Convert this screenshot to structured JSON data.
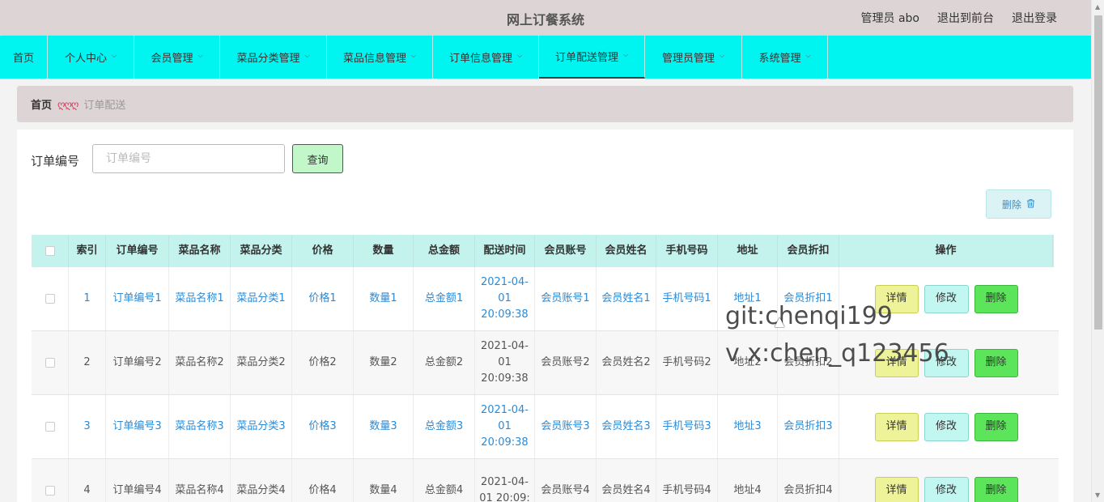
{
  "header": {
    "title": "网上订餐系统",
    "user_label": "管理员 abo",
    "front_link": "退出到前台",
    "logout_link": "退出登录"
  },
  "nav": {
    "home": "首页",
    "items": [
      {
        "label": "个人中心"
      },
      {
        "label": "会员管理"
      },
      {
        "label": "菜品分类管理"
      },
      {
        "label": "菜品信息管理"
      },
      {
        "label": "订单信息管理"
      },
      {
        "label": "订单配送管理",
        "active": true
      },
      {
        "label": "管理员管理"
      },
      {
        "label": "系统管理"
      }
    ],
    "chevron": "⌵"
  },
  "breadcrumb": {
    "home": "首页",
    "separator": "ღღღ",
    "current": "订单配送"
  },
  "search": {
    "label": "订单编号",
    "placeholder": "订单编号",
    "button": "查询"
  },
  "toolbar": {
    "delete_label": "删除",
    "trash_icon": "🗑"
  },
  "table": {
    "headers": [
      "索引",
      "订单编号",
      "菜品名称",
      "菜品分类",
      "价格",
      "数量",
      "总金额",
      "配送时间",
      "会员账号",
      "会员姓名",
      "手机号码",
      "地址",
      "会员折扣",
      "操作"
    ],
    "actions": {
      "detail": "详情",
      "edit": "修改",
      "delete": "删除"
    },
    "rows": [
      [
        "1",
        "订单编号1",
        "菜品名称1",
        "菜品分类1",
        "价格1",
        "数量1",
        "总金额1",
        "2021-04-01 20:09:38",
        "会员账号1",
        "会员姓名1",
        "手机号码1",
        "地址1",
        "会员折扣1"
      ],
      [
        "2",
        "订单编号2",
        "菜品名称2",
        "菜品分类2",
        "价格2",
        "数量2",
        "总金额2",
        "2021-04-01 20:09:38",
        "会员账号2",
        "会员姓名2",
        "手机号码2",
        "地址2",
        "会员折扣2"
      ],
      [
        "3",
        "订单编号3",
        "菜品名称3",
        "菜品分类3",
        "价格3",
        "数量3",
        "总金额3",
        "2021-04-01 20:09:38",
        "会员账号3",
        "会员姓名3",
        "手机号码3",
        "地址3",
        "会员折扣3"
      ],
      [
        "4",
        "订单编号4",
        "菜品名称4",
        "菜品分类4",
        "价格4",
        "数量4",
        "总金额4",
        "2021-04-01 20:09:",
        "会员账号4",
        "会员姓名4",
        "手机号码4",
        "地址4",
        "会员折扣4"
      ]
    ]
  },
  "watermark": {
    "line1": "git:chenqi199",
    "line2": "v x:chen_q123456"
  },
  "colors": {
    "nav_bg": "#00f4f0",
    "header_bg": "#ddd5d5",
    "link_blue": "#2b8ad6",
    "detail_btn": "#eef39a",
    "edit_btn": "#c1f6f1",
    "delete_btn": "#5ce55a"
  }
}
